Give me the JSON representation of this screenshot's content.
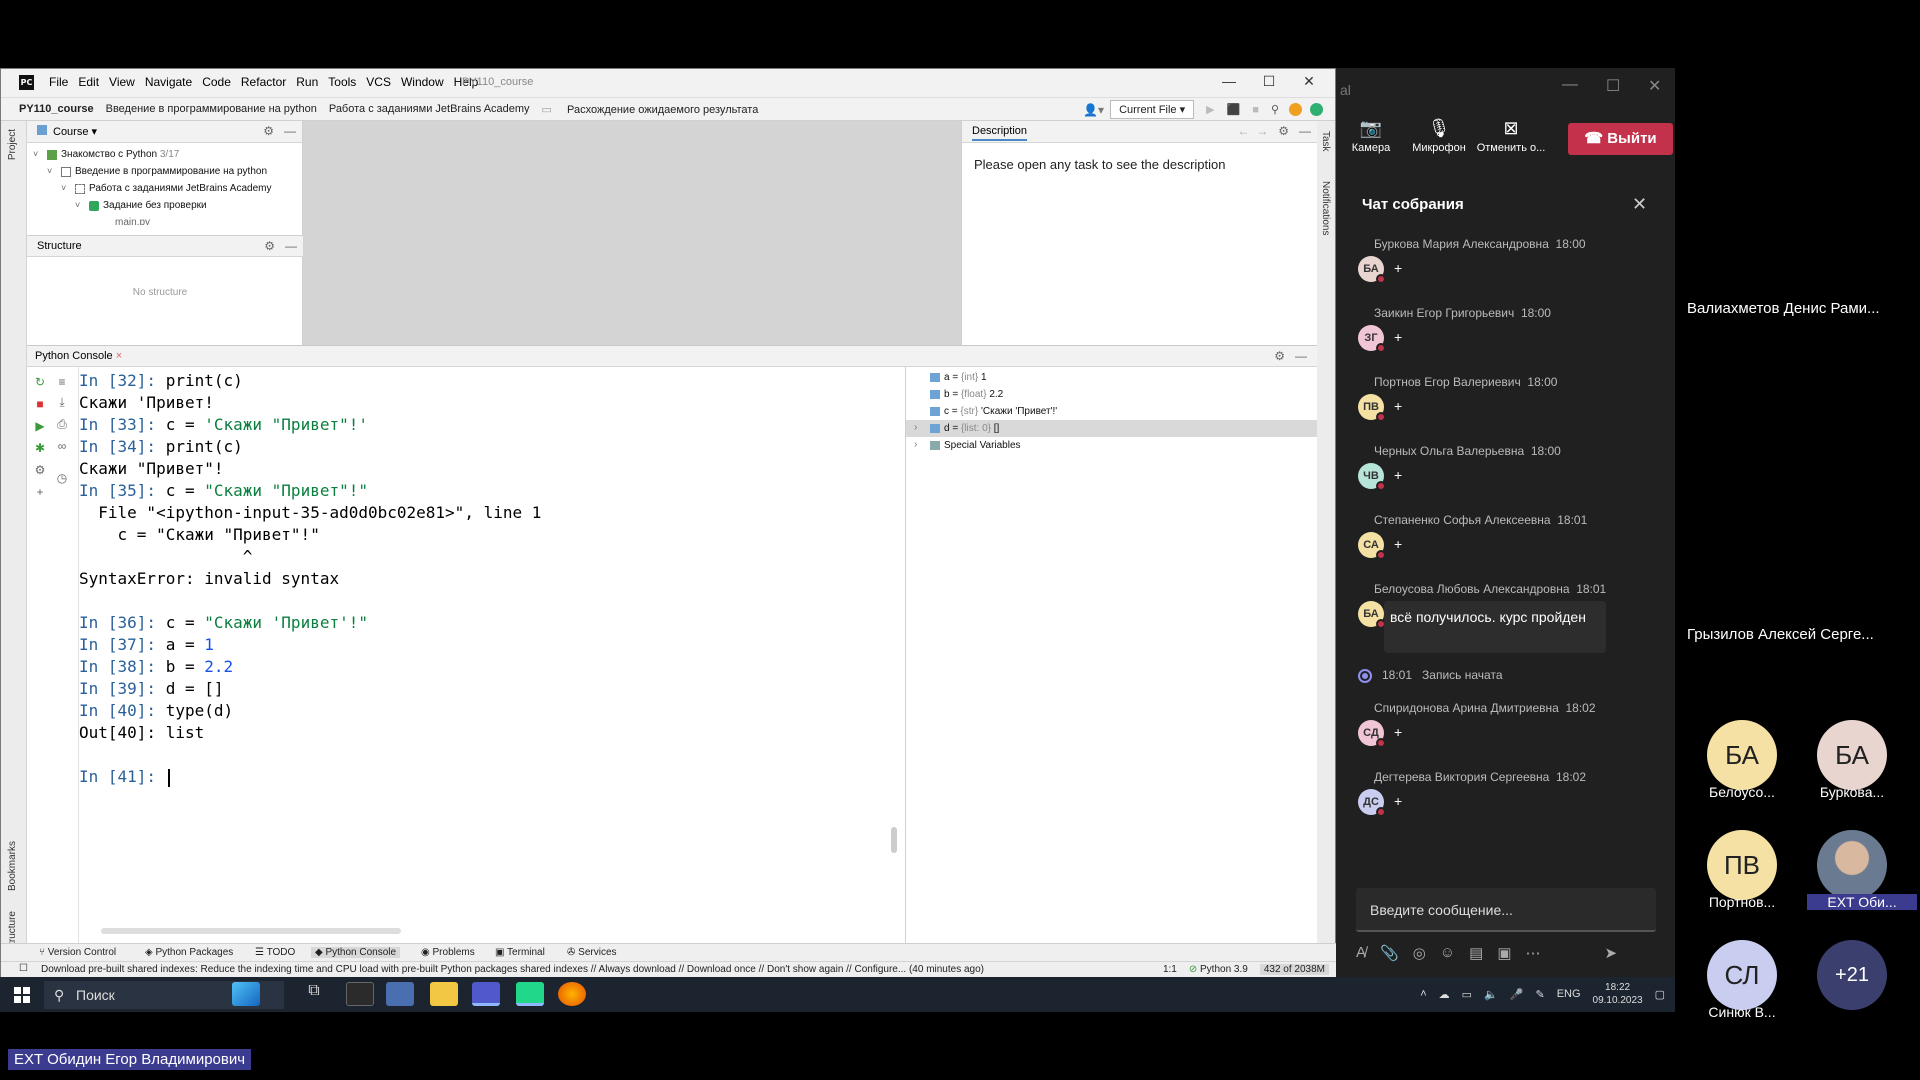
{
  "ide": {
    "logo": "PC",
    "menu": [
      "File",
      "Edit",
      "View",
      "Navigate",
      "Code",
      "Refactor",
      "Run",
      "Tools",
      "VCS",
      "Window",
      "Help"
    ],
    "project_title": "PY110_course",
    "window_buttons": [
      "—",
      "☐",
      "✕"
    ],
    "breadcrumbs": [
      "PY110_course",
      "Введение в программирование на python",
      "Работа с заданиями JetBrains Academy",
      "Расхождение ожидаемого результата"
    ],
    "current_file": "Current File",
    "left_stripe": {
      "project": "Project",
      "bookmarks": "Bookmarks",
      "structure": "Structure"
    },
    "right_stripe": {
      "task": "Task",
      "notifications": "Notifications"
    },
    "course_panel": {
      "title": "Course",
      "tree": [
        {
          "label": "Знакомство с Python",
          "count": "3/17"
        },
        {
          "label": "Введение в программирование на python"
        },
        {
          "label": "Работа с заданиями JetBrains Academy"
        },
        {
          "label": "Задание без проверки"
        },
        {
          "label": "main.py"
        }
      ]
    },
    "structure_panel": {
      "title": "Structure",
      "empty_text": "No structure"
    },
    "description_panel": {
      "title": "Description",
      "text": "Please open any task to see the description"
    },
    "console": {
      "tab": "Python Console",
      "lines": [
        {
          "prompt": "In [32]: ",
          "code": "print(c)"
        },
        {
          "output": "Скажи 'Привет!"
        },
        {
          "prompt": "In [33]: ",
          "code": "c = ",
          "str": "'Скажи \"Привет\"!'"
        },
        {
          "prompt": "In [34]: ",
          "code": "print(c)"
        },
        {
          "output": "Скажи \"Привет\"!"
        },
        {
          "prompt": "In [35]: ",
          "code": "c = ",
          "str": "\"Скажи \"Привет\"!\""
        },
        {
          "output": "  File \"<ipython-input-35-ad0d0bc02e81>\", line 1"
        },
        {
          "output": "    c = \"Скажи \"Привет\"!\""
        },
        {
          "output": "                 ^"
        },
        {
          "output": "SyntaxError: invalid syntax"
        },
        {
          "output": ""
        },
        {
          "prompt": "In [36]: ",
          "code": "c = ",
          "str": "\"Скажи 'Привет'!\""
        },
        {
          "prompt": "In [37]: ",
          "code": "a = ",
          "num": "1"
        },
        {
          "prompt": "In [38]: ",
          "code": "b = ",
          "num": "2.2"
        },
        {
          "prompt": "In [39]: ",
          "code": "d = []"
        },
        {
          "prompt": "In [40]: ",
          "code": "type(d)"
        },
        {
          "output": "Out[40]: list"
        },
        {
          "output": ""
        },
        {
          "prompt": "In [41]: ",
          "code": ""
        }
      ]
    },
    "variables": [
      {
        "name": "a = ",
        "type": "{int} ",
        "value": "1"
      },
      {
        "name": "b = ",
        "type": "{float} ",
        "value": "2.2"
      },
      {
        "name": "c = ",
        "type": "{str} ",
        "value": "'Скажи 'Привет'!'"
      },
      {
        "name": "d = ",
        "type": "{list: 0} ",
        "value": "[]"
      },
      {
        "name": "Special Variables",
        "type": "",
        "value": ""
      }
    ],
    "bottom_tabs": [
      "Version Control",
      "Python Packages",
      "TODO",
      "Python Console",
      "Problems",
      "Terminal",
      "Services"
    ],
    "status": {
      "message": "Download pre-built shared indexes: Reduce the indexing time and CPU load with pre-built Python packages shared indexes // Always download // Download once // Don't show again // Configure... (40 minutes ago)",
      "position": "1:1",
      "interpreter": "Python 3.9",
      "memory": "432 of 2038M"
    }
  },
  "taskbar": {
    "search_placeholder": "Поиск",
    "lang": "ENG",
    "time": "18:22",
    "date": "09.10.2023"
  },
  "teams": {
    "controls": [
      "Камера",
      "Микрофон",
      "Отменить о..."
    ],
    "leave": "Выйти",
    "chat_title": "Чат собрания",
    "messages": [
      {
        "author": "Буркова Мария Александровна",
        "time": "18:00",
        "initials": "БА",
        "color": "#e8d5d0",
        "body": "+"
      },
      {
        "author": "Заикин Егор Григорьевич",
        "time": "18:00",
        "initials": "ЗГ",
        "color": "#f0c6d6",
        "body": "+"
      },
      {
        "author": "Портнов Егор Валериевич",
        "time": "18:00",
        "initials": "ПВ",
        "color": "#f5e1a4",
        "body": "+"
      },
      {
        "author": "Черных Ольга Валерьевна",
        "time": "18:00",
        "initials": "ЧВ",
        "color": "#b7e4d8",
        "body": "+"
      },
      {
        "author": "Степаненко Софья Алексеевна",
        "time": "18:01",
        "initials": "СА",
        "color": "#f5e1a4",
        "body": "+"
      },
      {
        "author": "Белоусова Любовь Александровна",
        "time": "18:01",
        "initials": "БА",
        "color": "#f5e1a4",
        "body": "всё получилось. курс пройден"
      },
      {
        "author": "Спиридонова Арина Дмитриевна",
        "time": "18:02",
        "initials": "СД",
        "color": "#f0c6d6",
        "body": "+"
      },
      {
        "author": "Дегтерева Виктория Сергеевна",
        "time": "18:02",
        "initials": "ДС",
        "color": "#c9cdf0",
        "body": "+"
      }
    ],
    "system_time": "18:01",
    "system_text": "Запись начата",
    "input_placeholder": "Введите сообщение..."
  },
  "participants": {
    "tiles": [
      "Валиахметов Денис Рами...",
      "Грызилов Алексей Серге..."
    ],
    "circles": [
      {
        "initials": "БА",
        "label": "Белоусо...",
        "color": "#f5e1a4"
      },
      {
        "initials": "БА",
        "label": "Буркова...",
        "color": "#e8d5d0"
      },
      {
        "initials": "ПВ",
        "label": "Портнов...",
        "color": "#f5e1a4"
      },
      {
        "initials": "",
        "label": "EXT Оби...",
        "color": "#6a7a90"
      },
      {
        "initials": "СЛ",
        "label": "Синюк В...",
        "color": "#c9cdf0"
      },
      {
        "initials": "+21",
        "label": "",
        "color": "#3a3f6e"
      }
    ],
    "bottom_name": "EXT Обидин Егор Владимирович"
  }
}
